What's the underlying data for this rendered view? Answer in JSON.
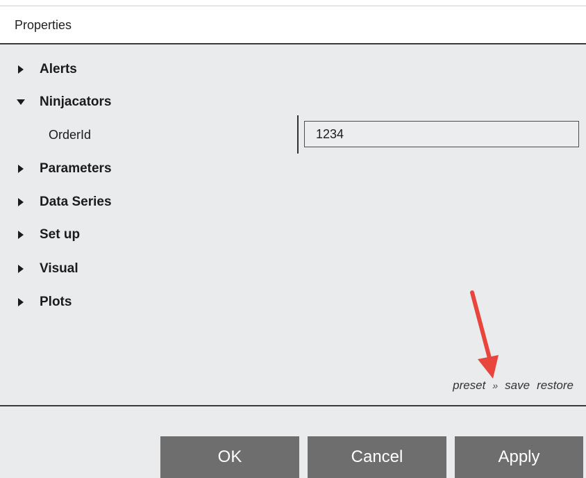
{
  "header": {
    "title": "Properties"
  },
  "sections": [
    {
      "label": "Alerts",
      "expanded": false,
      "icon": "caret-right-icon"
    },
    {
      "label": "Ninjacators",
      "expanded": true,
      "icon": "caret-down-icon",
      "properties": [
        {
          "label": "OrderId",
          "value": "1234"
        }
      ]
    },
    {
      "label": "Parameters",
      "expanded": false,
      "icon": "caret-right-icon"
    },
    {
      "label": "Data Series",
      "expanded": false,
      "icon": "caret-right-icon"
    },
    {
      "label": "Set up",
      "expanded": false,
      "icon": "caret-right-icon"
    },
    {
      "label": "Visual",
      "expanded": false,
      "icon": "caret-right-icon"
    },
    {
      "label": "Plots",
      "expanded": false,
      "icon": "caret-right-icon"
    }
  ],
  "preset": {
    "label": "preset",
    "separator": "»",
    "save": "save",
    "restore": "restore"
  },
  "buttons": {
    "ok": "OK",
    "cancel": "Cancel",
    "apply": "Apply"
  },
  "colors": {
    "panel_bg": "#e9ebed",
    "button_bg": "#6e6e6e",
    "annotation_arrow": "#e8453c"
  }
}
